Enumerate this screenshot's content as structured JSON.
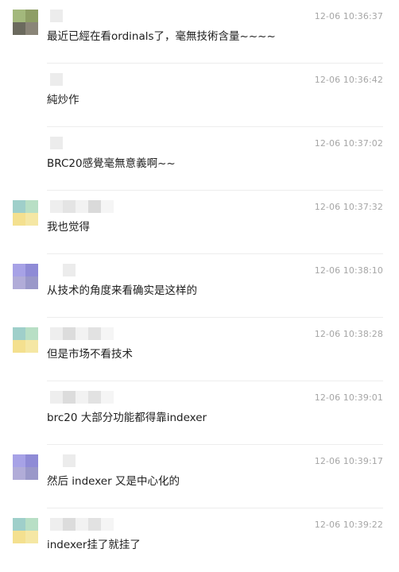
{
  "messages": [
    {
      "time": "12-06 10:36:37",
      "text": "最近已經在看ordinals了，毫無技術含量~~~~",
      "avatar": [
        "#a3b87c",
        "#8e9e65",
        "#6b6a5e",
        "#8a8578"
      ],
      "name_blocks": [
        "#ececec"
      ]
    },
    {
      "time": "12-06 10:36:42",
      "text": "純炒作",
      "avatar": null,
      "name_blocks": [
        "#ececec"
      ]
    },
    {
      "time": "12-06 10:37:02",
      "text": "BRC20感覺毫無意義啊~~",
      "avatar": null,
      "name_blocks": [
        "#ececec"
      ]
    },
    {
      "time": "12-06 10:37:32",
      "text": "我也觉得",
      "avatar": [
        "#9fcfca",
        "#b8dfc5",
        "#f4e08f",
        "#f5e7a4"
      ],
      "name_blocks": [
        "#eeeeee",
        "#e4e4e4",
        "#f2f2f2",
        "#dadada",
        "#f5f5f5"
      ]
    },
    {
      "time": "12-06 10:38:10",
      "text": "从技术的角度来看确实是这样的",
      "avatar": [
        "#a7a2e6",
        "#8f8bd6",
        "#b1acd8",
        "#9a98c9"
      ],
      "name_blocks": [
        "#ffffff",
        "#ececec"
      ]
    },
    {
      "time": "12-06 10:38:28",
      "text": "但是市场不看技术",
      "avatar": [
        "#9fcfca",
        "#b8dfc5",
        "#f4e08f",
        "#f5e7a4"
      ],
      "name_blocks": [
        "#eeeeee",
        "#dcdcdc",
        "#f2f2f2",
        "#e2e2e2",
        "#f5f5f5"
      ]
    },
    {
      "time": "12-06 10:39:01",
      "text": "brc20 大部分功能都得靠indexer",
      "avatar": null,
      "name_blocks": [
        "#eeeeee",
        "#dcdcdc",
        "#f2f2f2",
        "#e2e2e2",
        "#f5f5f5"
      ]
    },
    {
      "time": "12-06 10:39:17",
      "text": "然后 indexer 又是中心化的",
      "avatar": [
        "#a7a2e6",
        "#8f8bd6",
        "#b1acd8",
        "#9a98c9"
      ],
      "name_blocks": [
        "#ffffff",
        "#ececec"
      ]
    },
    {
      "time": "12-06 10:39:22",
      "text": "indexer挂了就挂了",
      "avatar": [
        "#9fcfca",
        "#b8dfc5",
        "#f4e08f",
        "#f5e7a4"
      ],
      "name_blocks": [
        "#eeeeee",
        "#dcdcdc",
        "#f2f2f2",
        "#e2e2e2",
        "#f5f5f5"
      ]
    }
  ]
}
